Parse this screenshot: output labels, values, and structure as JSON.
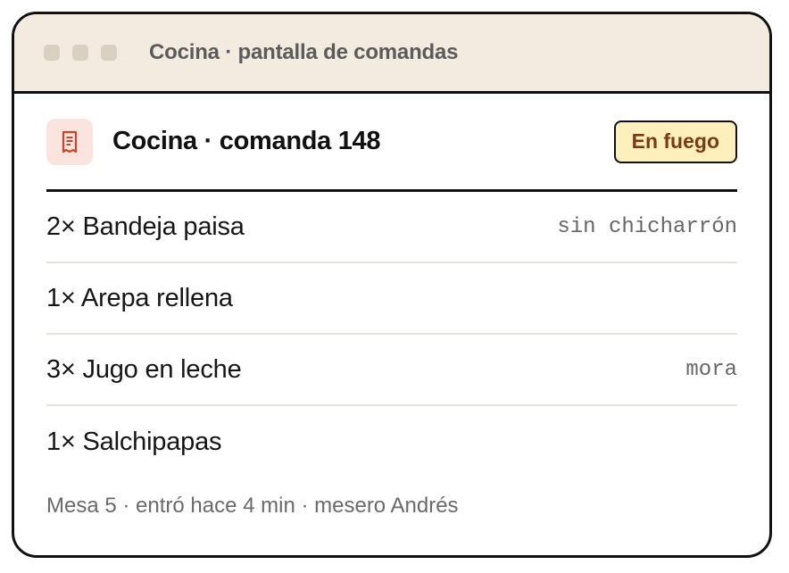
{
  "window": {
    "title": "Cocina · pantalla de comandas"
  },
  "ticket": {
    "icon": "receipt-icon",
    "title": "Cocina · comanda 148",
    "status": "En fuego",
    "items": [
      {
        "name": "2× Bandeja paisa",
        "note": "sin chicharrón"
      },
      {
        "name": "1× Arepa rellena",
        "note": ""
      },
      {
        "name": "3× Jugo en leche",
        "note": "mora"
      },
      {
        "name": "1× Salchipapas",
        "note": ""
      }
    ],
    "footer": "Mesa 5 · entró hace 4 min · mesero Andrés"
  },
  "colors": {
    "titlebar_bg": "#f3ebe0",
    "status_bg": "#fdf0bd",
    "status_text": "#7a3a12",
    "icon_bg": "#fbe4de",
    "icon_accent": "#c8442c"
  }
}
